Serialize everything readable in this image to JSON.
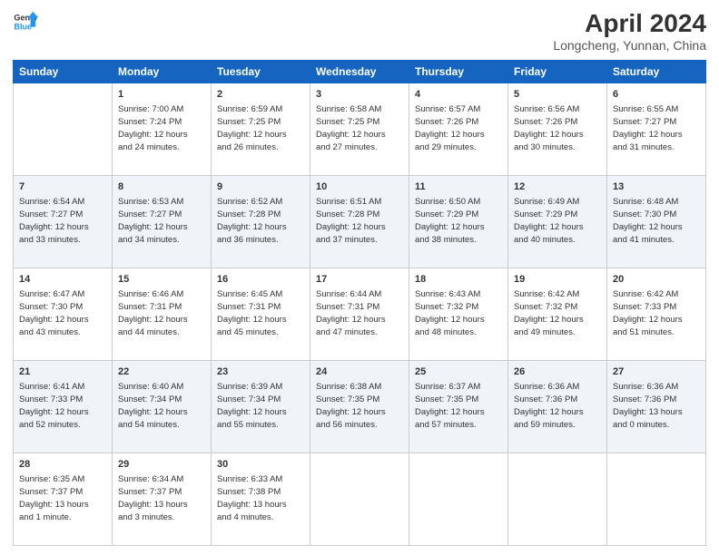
{
  "logo": {
    "line1": "General",
    "line2": "Blue"
  },
  "title": "April 2024",
  "subtitle": "Longcheng, Yunnan, China",
  "columns": [
    "Sunday",
    "Monday",
    "Tuesday",
    "Wednesday",
    "Thursday",
    "Friday",
    "Saturday"
  ],
  "weeks": [
    [
      {
        "day": "",
        "data": ""
      },
      {
        "day": "1",
        "data": "Sunrise: 7:00 AM\nSunset: 7:24 PM\nDaylight: 12 hours\nand 24 minutes."
      },
      {
        "day": "2",
        "data": "Sunrise: 6:59 AM\nSunset: 7:25 PM\nDaylight: 12 hours\nand 26 minutes."
      },
      {
        "day": "3",
        "data": "Sunrise: 6:58 AM\nSunset: 7:25 PM\nDaylight: 12 hours\nand 27 minutes."
      },
      {
        "day": "4",
        "data": "Sunrise: 6:57 AM\nSunset: 7:26 PM\nDaylight: 12 hours\nand 29 minutes."
      },
      {
        "day": "5",
        "data": "Sunrise: 6:56 AM\nSunset: 7:26 PM\nDaylight: 12 hours\nand 30 minutes."
      },
      {
        "day": "6",
        "data": "Sunrise: 6:55 AM\nSunset: 7:27 PM\nDaylight: 12 hours\nand 31 minutes."
      }
    ],
    [
      {
        "day": "7",
        "data": "Sunrise: 6:54 AM\nSunset: 7:27 PM\nDaylight: 12 hours\nand 33 minutes."
      },
      {
        "day": "8",
        "data": "Sunrise: 6:53 AM\nSunset: 7:27 PM\nDaylight: 12 hours\nand 34 minutes."
      },
      {
        "day": "9",
        "data": "Sunrise: 6:52 AM\nSunset: 7:28 PM\nDaylight: 12 hours\nand 36 minutes."
      },
      {
        "day": "10",
        "data": "Sunrise: 6:51 AM\nSunset: 7:28 PM\nDaylight: 12 hours\nand 37 minutes."
      },
      {
        "day": "11",
        "data": "Sunrise: 6:50 AM\nSunset: 7:29 PM\nDaylight: 12 hours\nand 38 minutes."
      },
      {
        "day": "12",
        "data": "Sunrise: 6:49 AM\nSunset: 7:29 PM\nDaylight: 12 hours\nand 40 minutes."
      },
      {
        "day": "13",
        "data": "Sunrise: 6:48 AM\nSunset: 7:30 PM\nDaylight: 12 hours\nand 41 minutes."
      }
    ],
    [
      {
        "day": "14",
        "data": "Sunrise: 6:47 AM\nSunset: 7:30 PM\nDaylight: 12 hours\nand 43 minutes."
      },
      {
        "day": "15",
        "data": "Sunrise: 6:46 AM\nSunset: 7:31 PM\nDaylight: 12 hours\nand 44 minutes."
      },
      {
        "day": "16",
        "data": "Sunrise: 6:45 AM\nSunset: 7:31 PM\nDaylight: 12 hours\nand 45 minutes."
      },
      {
        "day": "17",
        "data": "Sunrise: 6:44 AM\nSunset: 7:31 PM\nDaylight: 12 hours\nand 47 minutes."
      },
      {
        "day": "18",
        "data": "Sunrise: 6:43 AM\nSunset: 7:32 PM\nDaylight: 12 hours\nand 48 minutes."
      },
      {
        "day": "19",
        "data": "Sunrise: 6:42 AM\nSunset: 7:32 PM\nDaylight: 12 hours\nand 49 minutes."
      },
      {
        "day": "20",
        "data": "Sunrise: 6:42 AM\nSunset: 7:33 PM\nDaylight: 12 hours\nand 51 minutes."
      }
    ],
    [
      {
        "day": "21",
        "data": "Sunrise: 6:41 AM\nSunset: 7:33 PM\nDaylight: 12 hours\nand 52 minutes."
      },
      {
        "day": "22",
        "data": "Sunrise: 6:40 AM\nSunset: 7:34 PM\nDaylight: 12 hours\nand 54 minutes."
      },
      {
        "day": "23",
        "data": "Sunrise: 6:39 AM\nSunset: 7:34 PM\nDaylight: 12 hours\nand 55 minutes."
      },
      {
        "day": "24",
        "data": "Sunrise: 6:38 AM\nSunset: 7:35 PM\nDaylight: 12 hours\nand 56 minutes."
      },
      {
        "day": "25",
        "data": "Sunrise: 6:37 AM\nSunset: 7:35 PM\nDaylight: 12 hours\nand 57 minutes."
      },
      {
        "day": "26",
        "data": "Sunrise: 6:36 AM\nSunset: 7:36 PM\nDaylight: 12 hours\nand 59 minutes."
      },
      {
        "day": "27",
        "data": "Sunrise: 6:36 AM\nSunset: 7:36 PM\nDaylight: 13 hours\nand 0 minutes."
      }
    ],
    [
      {
        "day": "28",
        "data": "Sunrise: 6:35 AM\nSunset: 7:37 PM\nDaylight: 13 hours\nand 1 minute."
      },
      {
        "day": "29",
        "data": "Sunrise: 6:34 AM\nSunset: 7:37 PM\nDaylight: 13 hours\nand 3 minutes."
      },
      {
        "day": "30",
        "data": "Sunrise: 6:33 AM\nSunset: 7:38 PM\nDaylight: 13 hours\nand 4 minutes."
      },
      {
        "day": "",
        "data": ""
      },
      {
        "day": "",
        "data": ""
      },
      {
        "day": "",
        "data": ""
      },
      {
        "day": "",
        "data": ""
      }
    ]
  ]
}
